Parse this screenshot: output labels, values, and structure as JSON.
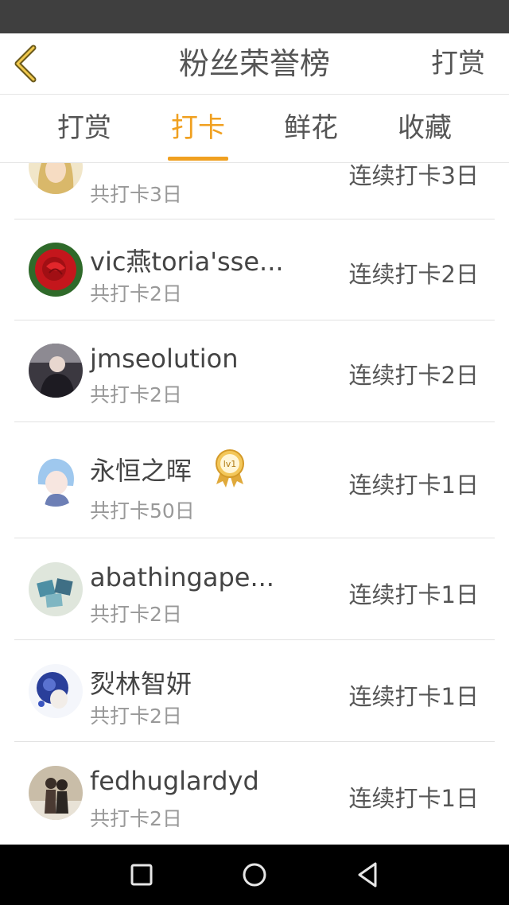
{
  "header": {
    "title": "粉丝荣誉榜",
    "action_label": "打赏",
    "back_icon": "chevron-left-icon",
    "accent_color": "#f0a020"
  },
  "tabs": [
    {
      "label": "打赏",
      "active": false
    },
    {
      "label": "打卡",
      "active": true
    },
    {
      "label": "鲜花",
      "active": false
    },
    {
      "label": "收藏",
      "active": false
    }
  ],
  "list": {
    "items": [
      {
        "name": "",
        "total": "共打卡3日",
        "streak": "连续打卡3日"
      },
      {
        "name": "vic燕toria'sse...",
        "total": "共打卡2日",
        "streak": "连续打卡2日"
      },
      {
        "name": "jmseolution",
        "total": "共打卡2日",
        "streak": "连续打卡2日"
      },
      {
        "name": "永恒之晖",
        "total": "共打卡50日",
        "streak": "连续打卡1日",
        "badge": "lv1"
      },
      {
        "name": "abathingape...",
        "total": "共打卡2日",
        "streak": "连续打卡1日"
      },
      {
        "name": "烮林智妍",
        "total": "共打卡2日",
        "streak": "连续打卡1日"
      },
      {
        "name": "fedhuglardyd",
        "total": "共打卡2日",
        "streak": "连续打卡1日"
      }
    ]
  },
  "nav_bar": {
    "icons": [
      "recent-apps-icon",
      "home-icon",
      "back-triangle-icon"
    ]
  }
}
